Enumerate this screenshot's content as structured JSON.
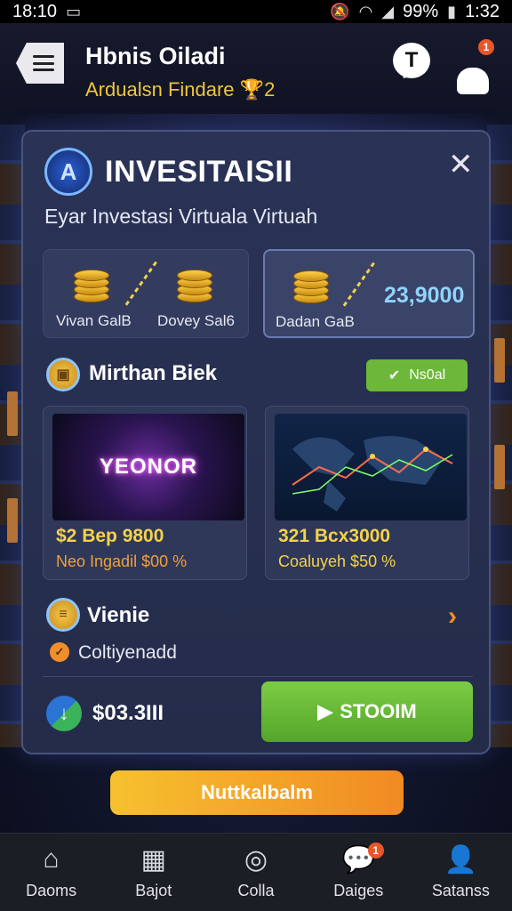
{
  "status_bar": {
    "time_left": "18:10",
    "battery": "99%",
    "time_right": "1:32"
  },
  "header": {
    "title": "Hbnis Oiladi",
    "subtitle": "Ardualsn Findare",
    "subtitle_badge": "🏆2",
    "chat_icon_glyph": "T",
    "notification_count": "1"
  },
  "card": {
    "title": "INVESITAISII",
    "description": "Eyar Investasi Virtuala Virtuah",
    "close_glyph": "✕",
    "stats": {
      "box1_label_left": "Vivan GalB",
      "box1_label_right": "Dovey Sal6",
      "box2_label": "Dadan GaB",
      "box2_value": "23,9000"
    },
    "section": {
      "title": "Mirthan Biek",
      "check_label": "Ns0al",
      "check_glyph": "✔"
    },
    "investments": [
      {
        "image_label": "YEONOR",
        "title": "$2 Bep 9800",
        "subtitle": "Neo Ingadil $00 %"
      },
      {
        "image_label": "",
        "title": "321 Bcx3000",
        "subtitle": "Coaluyeh $50 %"
      }
    ],
    "viewer": {
      "title": "Vienie",
      "chevron": "›",
      "config_text": "Coltiyenadd",
      "config_badge": "✓"
    },
    "wallet": {
      "amount": "$03.3III",
      "button_label": "STOOIM",
      "button_glyph": "▶"
    }
  },
  "cta": {
    "label": "Nuttkalbalm"
  },
  "bottom_nav": [
    {
      "label": "Daoms",
      "icon": "home-icon"
    },
    {
      "label": "Bajot",
      "icon": "bag-icon"
    },
    {
      "label": "Colla",
      "icon": "camera-icon"
    },
    {
      "label": "Daiges",
      "icon": "chat-bubble-icon",
      "badge": "1"
    },
    {
      "label": "Satanss",
      "icon": "person-icon"
    }
  ],
  "colors": {
    "accent_green": "#6db83a",
    "accent_orange": "#f18a23",
    "accent_gold": "#f4d24a",
    "card_bg": "#2a3356"
  }
}
